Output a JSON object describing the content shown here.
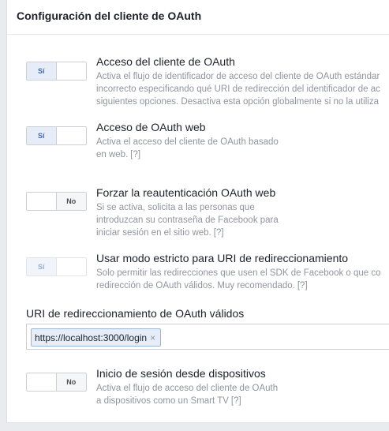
{
  "panel": {
    "title": "Configuración del cliente de OAuth"
  },
  "settings": [
    {
      "title": "Acceso del cliente de OAuth",
      "toggle": "Sí",
      "desc_lines": [
        "Activa el flujo de identificador de acceso del cliente de OAuth estándar",
        "incorrecto especificando qué URI de redirección del identificador de ac",
        "siguientes opciones. Desactiva esta opción globalmente si no la utiliza"
      ],
      "help": ""
    },
    {
      "title": "Acceso de OAuth web",
      "toggle": "Sí",
      "desc_lines": [
        "Activa el acceso del cliente de OAuth basado",
        "en web."
      ],
      "help": "[?]"
    },
    {
      "title": "Forzar la reautenticación OAuth web",
      "toggle": "No",
      "desc_lines": [
        "Si se activa, solicita a las personas que",
        "introduzcan su contraseña de Facebook para",
        "iniciar sesión en el sitio web."
      ],
      "help": "[?]"
    },
    {
      "title": "Usar modo estricto para URI de redireccionamiento",
      "toggle": "Sí",
      "desc_lines": [
        "Solo permitir las redirecciones que usen el SDK de Facebook o que co",
        "redirección de OAuth válidos. Muy recomendado."
      ],
      "help": "[?]"
    },
    {
      "title": "Inicio de sesión desde dispositivos",
      "toggle": "No",
      "desc_lines": [
        "Activa el flujo de acceso del cliente de OAuth",
        "a dispositivos como un Smart TV"
      ],
      "help": "[?]"
    }
  ],
  "redirect_uris": {
    "label": "URI de redireccionamiento de OAuth válidos",
    "tokens": [
      "https://localhost:3000/login"
    ],
    "remove_glyph": "×"
  }
}
